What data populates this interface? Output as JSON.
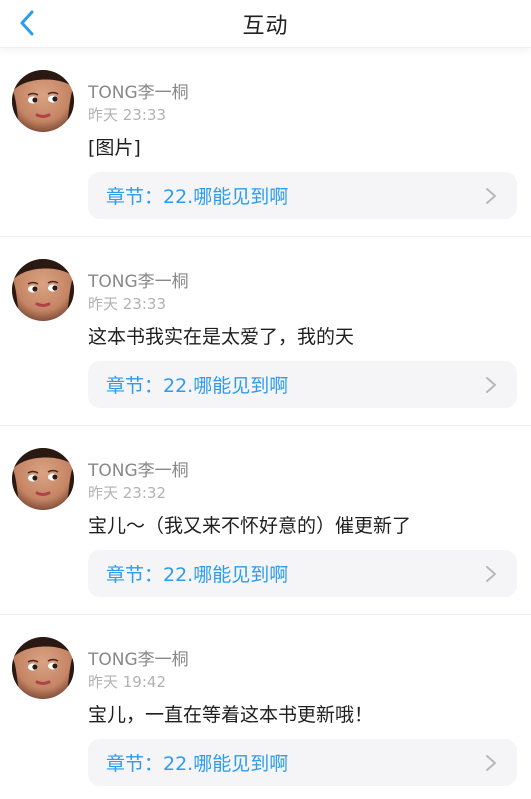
{
  "header": {
    "title": "互动",
    "back_icon": "chevron-left-icon",
    "accent_color": "#2c9cec"
  },
  "comments": [
    {
      "user": "TONG李一桐",
      "time": "昨天 23:33",
      "content": "[图片]",
      "chapter_label": "章节：22.哪能见到啊"
    },
    {
      "user": "TONG李一桐",
      "time": "昨天 23:33",
      "content": "这本书我实在是太爱了，我的天",
      "chapter_label": "章节：22.哪能见到啊"
    },
    {
      "user": "TONG李一桐",
      "time": "昨天 23:32",
      "content": "宝儿～（我又来不怀好意的）催更新了",
      "chapter_label": "章节：22.哪能见到啊"
    },
    {
      "user": "TONG李一桐",
      "time": "昨天 19:42",
      "content": "宝儿，一直在等着这本书更新哦！",
      "chapter_label": "章节：22.哪能见到啊"
    }
  ]
}
